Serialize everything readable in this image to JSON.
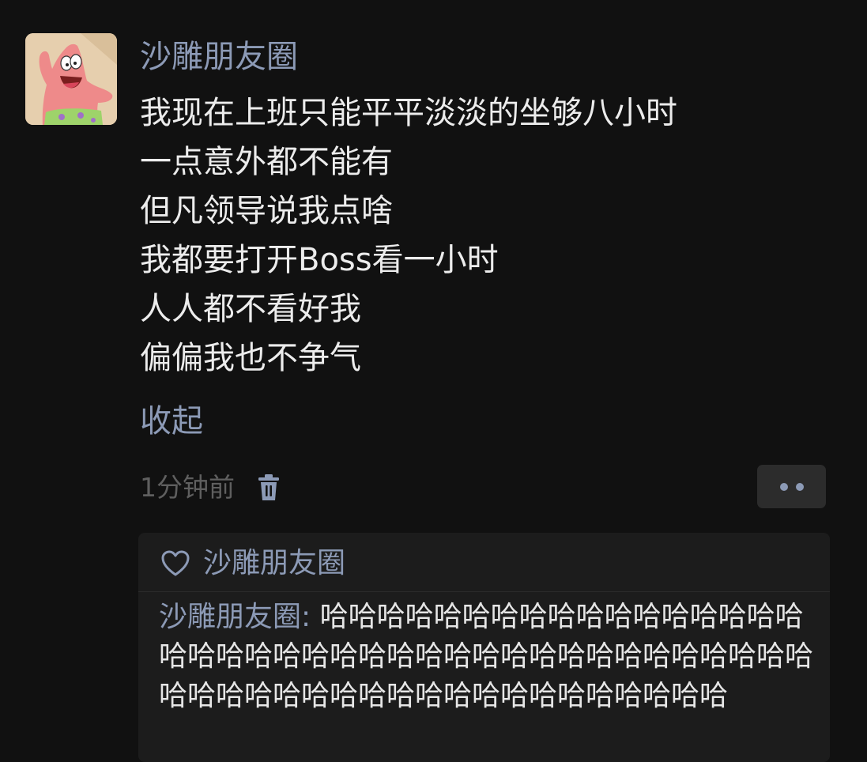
{
  "post": {
    "username": "沙雕朋友圈",
    "avatar_icon": "patrick-star-avatar-icon",
    "lines": [
      "我现在上班只能平平淡淡的坐够八小时",
      "一点意外都不能有",
      "但凡领导说我点啥",
      "我都要打开Boss看一小时",
      "人人都不看好我",
      "偏偏我也不争气"
    ],
    "collapse_label": "收起",
    "timestamp": "1分钟前",
    "delete_icon": "trash-icon",
    "more_icon": "more-dots-icon"
  },
  "interactions": {
    "like_icon": "heart-icon",
    "likes": "沙雕朋友圈",
    "comment": {
      "author": "沙雕朋友圈",
      "separator": ": ",
      "text": "哈哈哈哈哈哈哈哈哈哈哈哈哈哈哈哈哈哈哈哈哈哈哈哈哈哈哈哈哈哈哈哈哈哈哈哈哈哈哈哈哈哈哈哈哈哈哈哈哈哈哈哈哈哈哈哈哈哈哈哈"
    }
  },
  "colors": {
    "background": "#111111",
    "link_blue": "#8c9ab6",
    "text": "#ececec",
    "muted": "#5f5f5f",
    "panel": "#1c1c1c"
  }
}
